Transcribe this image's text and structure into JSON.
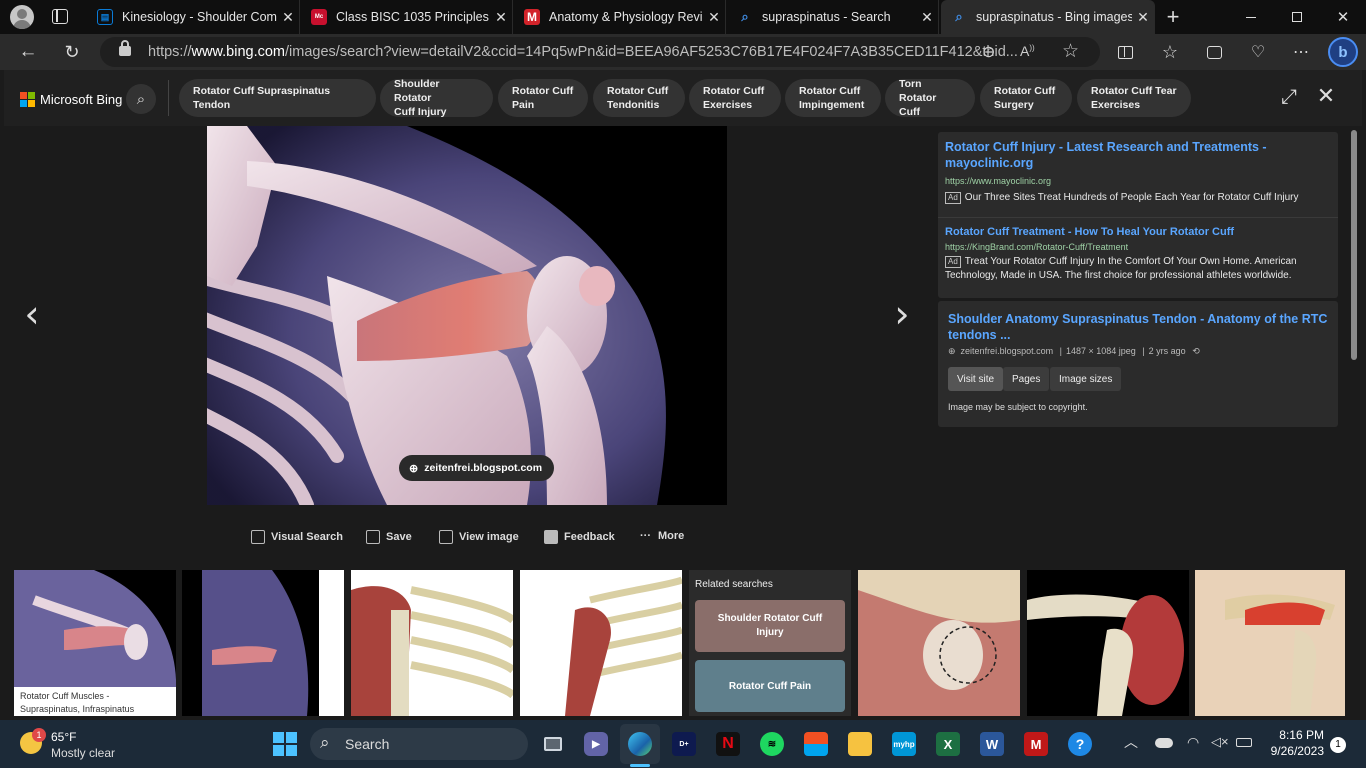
{
  "browser": {
    "tabs": [
      {
        "title": "Kinesiology - Shoulder Com",
        "favicon": "kinesiology-favicon",
        "color": "#0a7bd7"
      },
      {
        "title": "Class BISC 1035 Principles o",
        "favicon": "class-favicon",
        "color": "#c8102e"
      },
      {
        "title": "Anatomy & Physiology Revi",
        "favicon": "anatomy-m-favicon",
        "color": "#d2232a"
      },
      {
        "title": "supraspinatus - Search",
        "favicon": "search-favicon",
        "color": "#3f8ae0"
      },
      {
        "title": "supraspinatus - Bing images",
        "favicon": "search-favicon",
        "color": "#3f8ae0"
      }
    ],
    "close_glyph": "✕",
    "new_tab_glyph": "+",
    "url_prefix": "https://",
    "url_domain": "www.bing.com",
    "url_rest": "/images/search?view=detailV2&ccid=14Pq5wPn&id=BEEA96AF5253C76B17E4F024F7A3B35CED11F412&thid..."
  },
  "bing": {
    "brand": "Microsoft Bing",
    "chips": [
      {
        "l1": "Rotator Cuff Supraspinatus Tendon",
        "l2": ""
      },
      {
        "l1": "Shoulder Rotator",
        "l2": "Cuff Injury"
      },
      {
        "l1": "Rotator Cuff",
        "l2": "Pain"
      },
      {
        "l1": "Rotator Cuff",
        "l2": "Tendonitis"
      },
      {
        "l1": "Rotator Cuff",
        "l2": "Exercises"
      },
      {
        "l1": "Rotator Cuff",
        "l2": "Impingement"
      },
      {
        "l1": "Torn Rotator",
        "l2": "Cuff"
      },
      {
        "l1": "Rotator Cuff",
        "l2": "Surgery"
      },
      {
        "l1": "Rotator Cuff Tear",
        "l2": "Exercises"
      }
    ],
    "image_source_badge": "zeitenfrei.blogspot.com",
    "actions": [
      "Visual Search",
      "Save",
      "View image",
      "Feedback",
      "More"
    ],
    "ads": [
      {
        "title": "Rotator Cuff Injury - Latest Research and Treatments - mayoclinic.org",
        "url": "https://www.mayoclinic.org",
        "badge": "Ad",
        "desc": "Our Three Sites Treat Hundreds of People Each Year for Rotator Cuff Injury"
      },
      {
        "title": "Rotator Cuff Treatment - How To Heal Your Rotator Cuff",
        "url": "https://KingBrand.com/Rotator-Cuff/Treatment",
        "badge": "Ad",
        "desc": "Treat Your Rotator Cuff Injury In the Comfort Of Your Own Home. American Technology, Made in USA. The first choice for professional athletes worldwide."
      }
    ],
    "result": {
      "title": "Shoulder Anatomy Supraspinatus Tendon - Anatomy of the RTC tendons ...",
      "domain": "zeitenfrei.blogspot.com",
      "dims": "1487 × 1084 jpeg",
      "age": "2 yrs ago",
      "buttons": [
        "Visit site",
        "Pages",
        "Image sizes"
      ],
      "copyright": "Image may be subject to copyright."
    },
    "thumb_caption": "Rotator Cuff Muscles - Supraspinatus, Infraspinatus",
    "related": {
      "header": "Related searches",
      "items": [
        "Shoulder Rotator Cuff Injury",
        "Rotator Cuff Pain"
      ]
    }
  },
  "taskbar": {
    "weather_temp": "65°F",
    "weather_desc": "Mostly clear",
    "weather_badge": "1",
    "search_label": "Search",
    "time": "8:16 PM",
    "date": "9/26/2023",
    "notif_count": "1"
  }
}
